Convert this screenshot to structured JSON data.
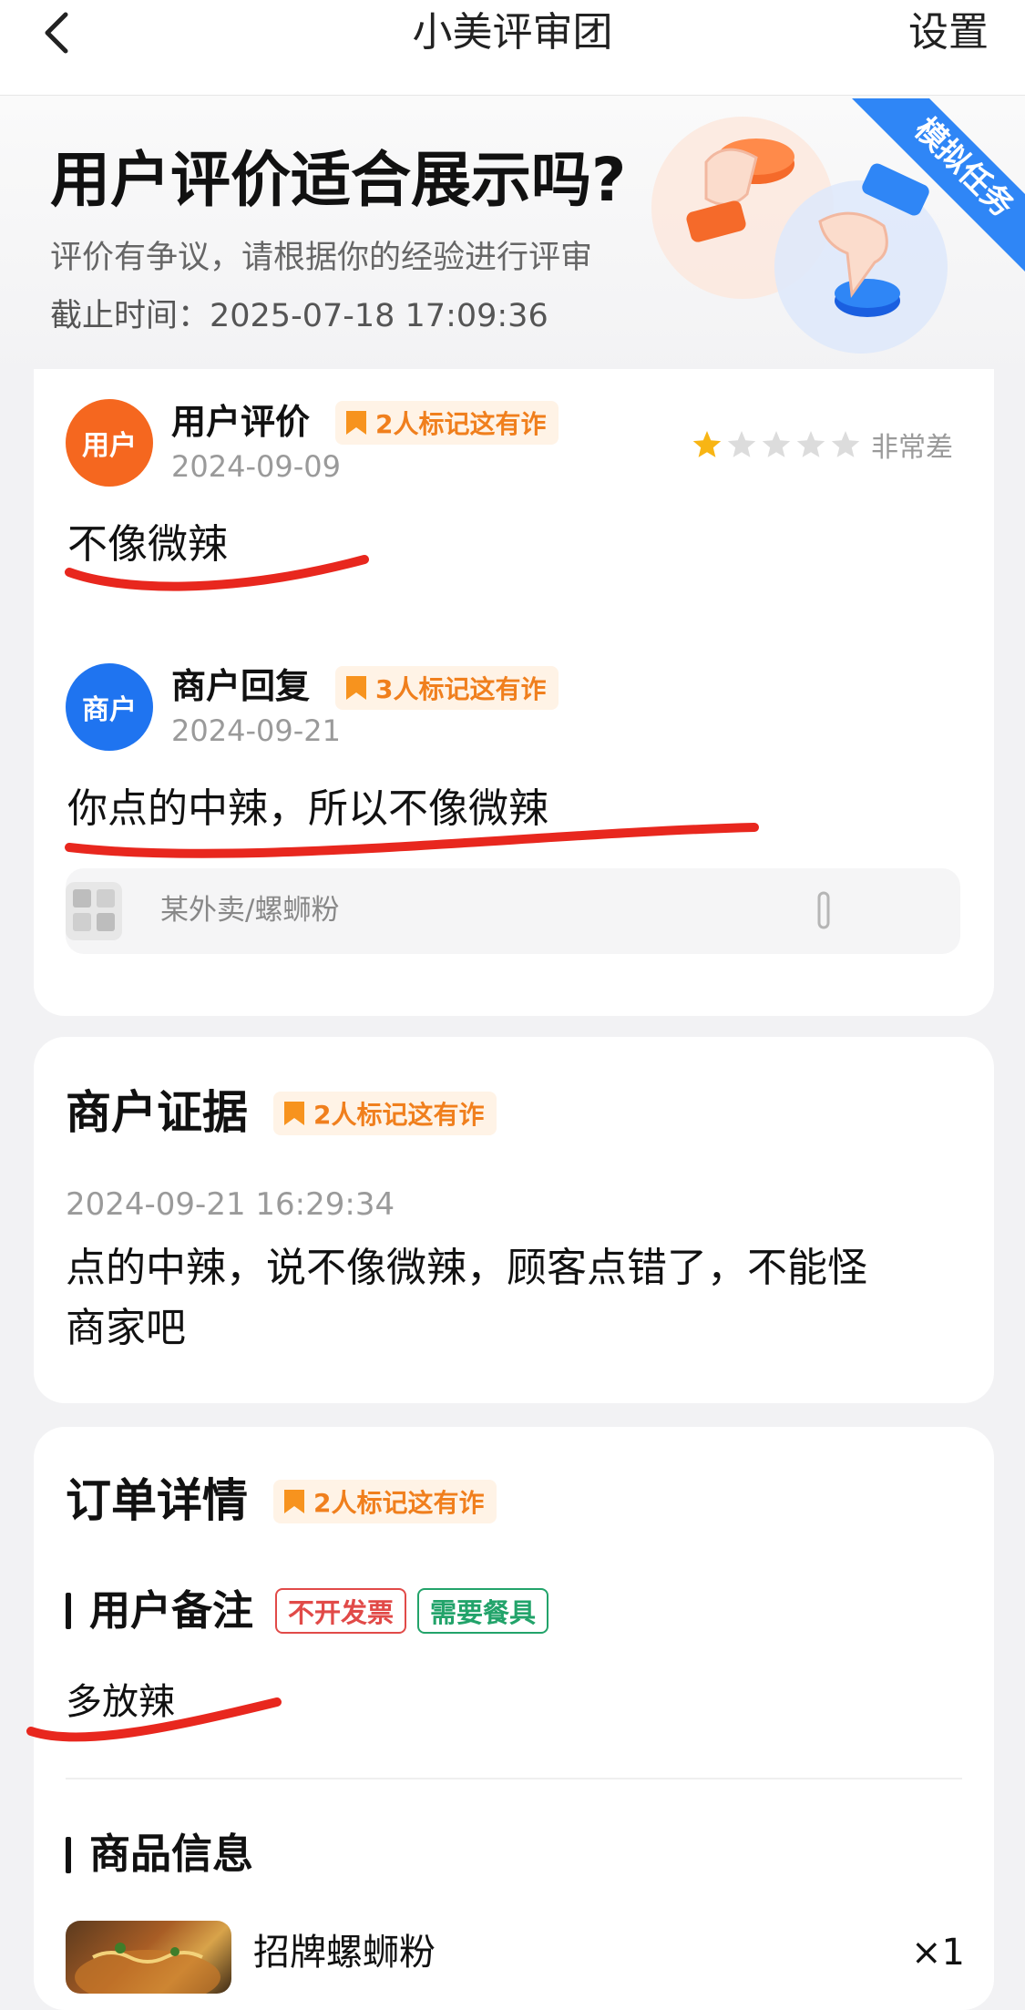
{
  "nav": {
    "title": "小美评审团",
    "settings_label": "设置"
  },
  "hero": {
    "title": "用户评价适合展示吗?",
    "subtitle": "评价有争议，请根据你的经验进行评审",
    "deadline": "截止时间：2025-07-18 17:09:36",
    "ribbon_text": "模拟任务"
  },
  "review": {
    "user_avatar_text": "用户",
    "user_name": "用户评价",
    "user_badge": "2人标记这有诈",
    "user_date": "2024-09-09",
    "rating_value": 1,
    "rating_max": 5,
    "rating_label": "非常差",
    "user_text": "不像微辣",
    "merchant_avatar_text": "商户",
    "merchant_name": "商户回复",
    "merchant_badge": "3人标记这有诈",
    "merchant_date": "2024-09-21",
    "merchant_text": "你点的中辣，所以不像微辣",
    "shop_text": "某外卖/螺蛳粉"
  },
  "evidence": {
    "title": "商户证据",
    "badge": "2人标记这有诈",
    "timestamp": "2024-09-21 16:29:34",
    "text_line1": "点的中辣，说不像微辣，顾客点错了，不能怪",
    "text_line2": "商家吧"
  },
  "order": {
    "title": "订单详情",
    "badge": "2人标记这有诈",
    "note_title": "用户备注",
    "tag_invoice": "不开发票",
    "tag_cutlery": "需要餐具",
    "note_text": "多放辣",
    "goods_title": "商品信息",
    "item_name": "招牌螺蛳粉",
    "item_qty": "×1"
  },
  "colors": {
    "user_avatar": "#f5671f",
    "merchant_avatar": "#1f74f0",
    "badge_text": "#f07f1d",
    "annotation_red": "#e8271e",
    "star_active": "#f8b514",
    "star_inactive": "#dcdcdc",
    "tag_invoice": "#e14a48",
    "tag_cutlery": "#22a36a",
    "ribbon": "#2f86f6"
  },
  "icons": {
    "back": "chevron-left-icon",
    "badge": "bookmark-icon",
    "star": "star-icon",
    "shop": "shop-thumbnail-icon",
    "scroll": "scroll-handle-icon"
  }
}
